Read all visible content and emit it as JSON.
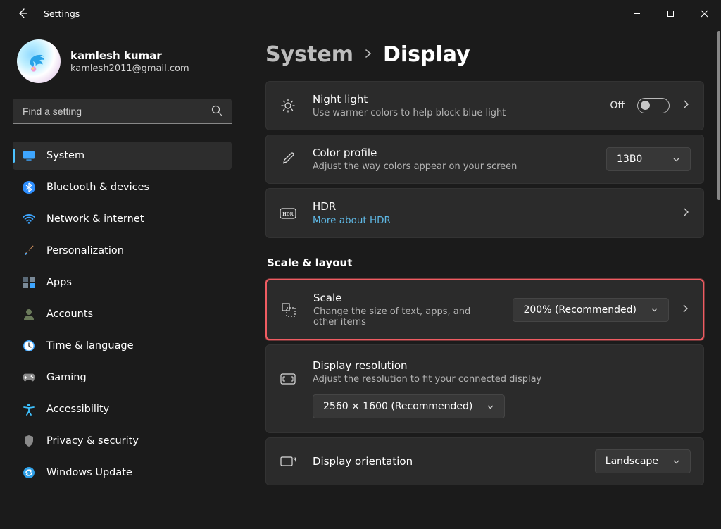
{
  "window": {
    "title": "Settings"
  },
  "profile": {
    "name": "kamlesh kumar",
    "email": "kamlesh2011@gmail.com"
  },
  "search": {
    "placeholder": "Find a setting"
  },
  "sidebar": {
    "items": [
      {
        "label": "System"
      },
      {
        "label": "Bluetooth & devices"
      },
      {
        "label": "Network & internet"
      },
      {
        "label": "Personalization"
      },
      {
        "label": "Apps"
      },
      {
        "label": "Accounts"
      },
      {
        "label": "Time & language"
      },
      {
        "label": "Gaming"
      },
      {
        "label": "Accessibility"
      },
      {
        "label": "Privacy & security"
      },
      {
        "label": "Windows Update"
      }
    ]
  },
  "breadcrumb": {
    "root": "System",
    "page": "Display"
  },
  "nightlight": {
    "title": "Night light",
    "sub": "Use warmer colors to help block blue light",
    "state": "Off"
  },
  "colorprofile": {
    "title": "Color profile",
    "sub": "Adjust the way colors appear on your screen",
    "value": "13B0"
  },
  "hdr": {
    "title": "HDR",
    "link": "More about HDR"
  },
  "section_scale": "Scale & layout",
  "scale": {
    "title": "Scale",
    "sub": "Change the size of text, apps, and other items",
    "value": "200% (Recommended)"
  },
  "resolution": {
    "title": "Display resolution",
    "sub": "Adjust the resolution to fit your connected display",
    "value": "2560 × 1600 (Recommended)"
  },
  "orientation": {
    "title": "Display orientation",
    "value": "Landscape"
  }
}
